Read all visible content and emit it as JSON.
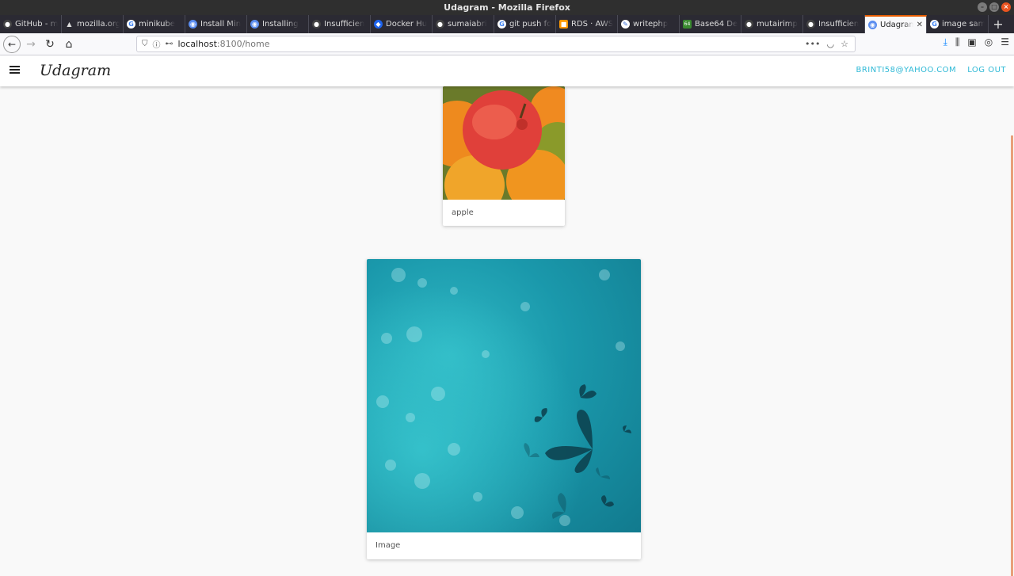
{
  "window": {
    "title": "Udagram - Mozilla Firefox"
  },
  "tabs": [
    {
      "label": "GitHub - m",
      "icon": "github-icon"
    },
    {
      "label": "mozilla.org",
      "icon": "warning-icon"
    },
    {
      "label": "minikube",
      "icon": "google-icon"
    },
    {
      "label": "Install Min",
      "icon": "site-icon"
    },
    {
      "label": "Installing",
      "icon": "site-icon"
    },
    {
      "label": "Insufficien",
      "icon": "github-icon"
    },
    {
      "label": "Docker Hu",
      "icon": "docker-icon"
    },
    {
      "label": "sumaiabri",
      "icon": "github-icon"
    },
    {
      "label": "git push fo",
      "icon": "google-icon"
    },
    {
      "label": "RDS · AWS",
      "icon": "aws-icon"
    },
    {
      "label": "writephp",
      "icon": "site-icon"
    },
    {
      "label": "Base64 De",
      "icon": "base64-icon"
    },
    {
      "label": "mutairimp",
      "icon": "github-icon"
    },
    {
      "label": "Insufficien",
      "icon": "github-icon"
    },
    {
      "label": "Udagram",
      "icon": "site-icon",
      "active": true
    },
    {
      "label": "image sam",
      "icon": "google-icon"
    }
  ],
  "navbar": {
    "url_host": "localhost",
    "url_path": ":8100/home"
  },
  "app": {
    "brand": "Udagram",
    "user_email": "BRINTI58@YAHOO.COM",
    "logout_label": "LOG OUT"
  },
  "feed": [
    {
      "caption": "apple",
      "image": "apples-and-oranges-photo"
    },
    {
      "caption": "Image",
      "image": "teal-bokeh-butterflies-photo"
    }
  ],
  "colors": {
    "accent": "#2fb9d6",
    "tab_indicator": "#e65c00"
  }
}
